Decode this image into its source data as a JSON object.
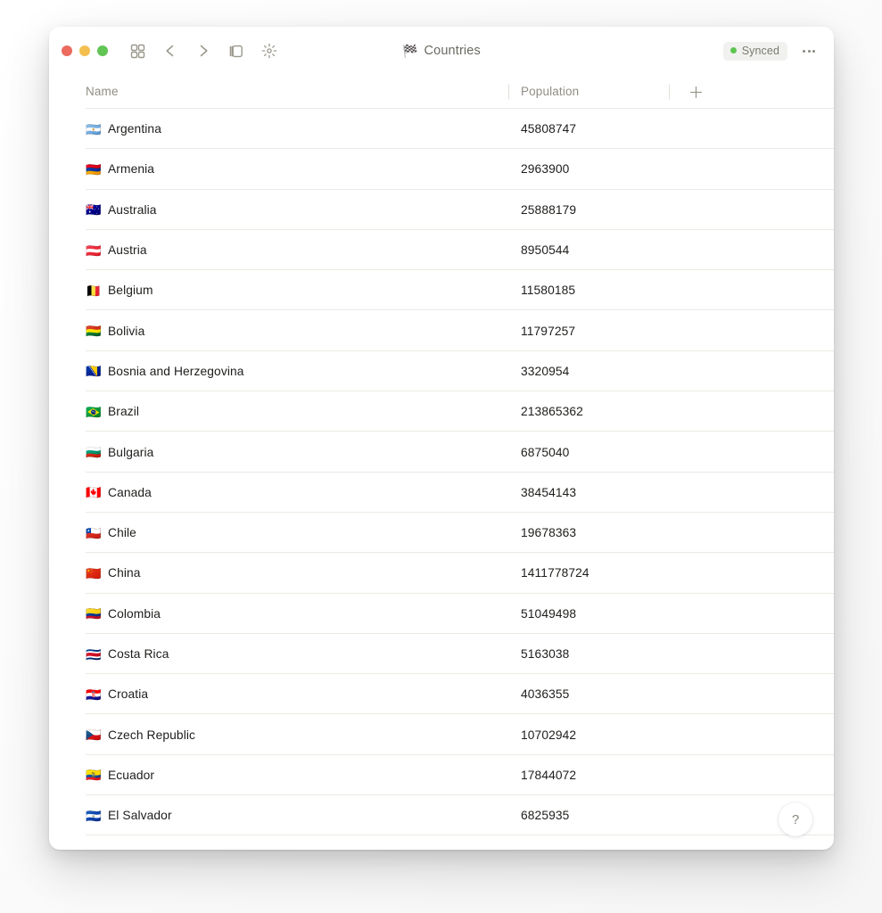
{
  "window": {
    "title_icon": "🏁",
    "title": "Countries",
    "traffic_lights": [
      {
        "name": "close",
        "color": "#ec6a5e"
      },
      {
        "name": "minimize",
        "color": "#f4bf4f"
      },
      {
        "name": "maximize",
        "color": "#61c554"
      }
    ]
  },
  "toolbar": {
    "left_icons": [
      {
        "name": "grid-view-icon",
        "label": "Grid view"
      },
      {
        "name": "back-chevron-icon",
        "label": "Back"
      },
      {
        "name": "forward-chevron-icon",
        "label": "Forward"
      },
      {
        "name": "sidebar-toggle-icon",
        "label": "Toggle sidebar"
      },
      {
        "name": "sparkle-icon",
        "label": "Highlight"
      }
    ],
    "sync_status": "Synced",
    "sync_color": "#5fc552",
    "more_label": "More options"
  },
  "table": {
    "columns": [
      {
        "key": "name",
        "label": "Name"
      },
      {
        "key": "population",
        "label": "Population"
      }
    ],
    "add_column_icon": "+",
    "rows": [
      {
        "flag": "🇦🇷",
        "name": "Argentina",
        "population": "45808747"
      },
      {
        "flag": "🇦🇲",
        "name": "Armenia",
        "population": "2963900"
      },
      {
        "flag": "🇦🇺",
        "name": "Australia",
        "population": "25888179"
      },
      {
        "flag": "🇦🇹",
        "name": "Austria",
        "population": "8950544"
      },
      {
        "flag": "🇧🇪",
        "name": "Belgium",
        "population": "11580185"
      },
      {
        "flag": "🇧🇴",
        "name": "Bolivia",
        "population": "11797257"
      },
      {
        "flag": "🇧🇦",
        "name": "Bosnia and Herzegovina",
        "population": "3320954"
      },
      {
        "flag": "🇧🇷",
        "name": "Brazil",
        "population": "213865362"
      },
      {
        "flag": "🇧🇬",
        "name": "Bulgaria",
        "population": "6875040"
      },
      {
        "flag": "🇨🇦",
        "name": "Canada",
        "population": "38454143"
      },
      {
        "flag": "🇨🇱",
        "name": "Chile",
        "population": "19678363"
      },
      {
        "flag": "🇨🇳",
        "name": "China",
        "population": "1411778724"
      },
      {
        "flag": "🇨🇴",
        "name": "Colombia",
        "population": "51049498"
      },
      {
        "flag": "🇨🇷",
        "name": "Costa Rica",
        "population": "5163038"
      },
      {
        "flag": "🇭🇷",
        "name": "Croatia",
        "population": "4036355"
      },
      {
        "flag": "🇨🇿",
        "name": "Czech Republic",
        "population": "10702942"
      },
      {
        "flag": "🇪🇨",
        "name": "Ecuador",
        "population": "17844072"
      },
      {
        "flag": "🇸🇻",
        "name": "El Salvador",
        "population": "6825935"
      }
    ]
  },
  "help": {
    "label": "?"
  }
}
